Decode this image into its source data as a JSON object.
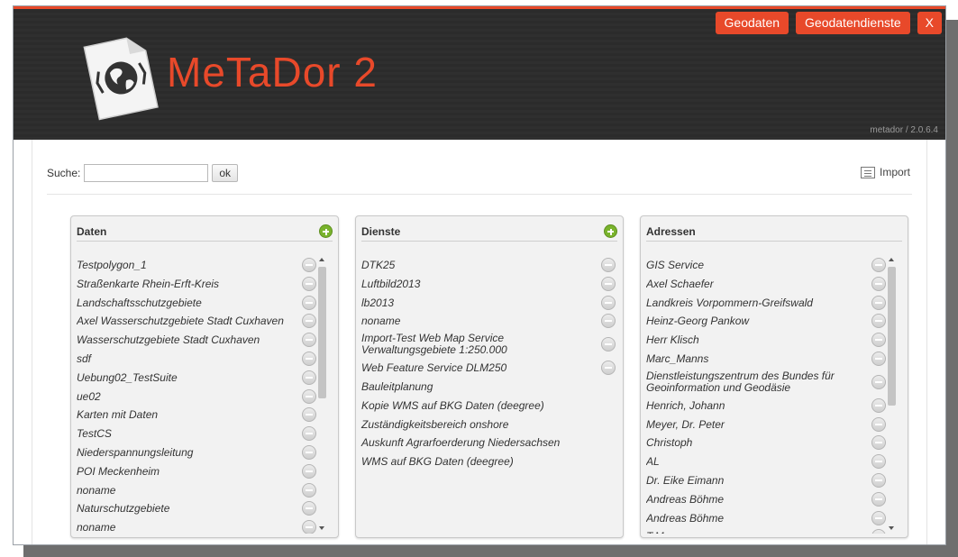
{
  "header": {
    "brand_part1": "MeTa",
    "brand_part2": "Dor 2",
    "version": "metador / 2.0.6.4",
    "nav": {
      "geodaten": "Geodaten",
      "geodatendienste": "Geodatendienste",
      "close": "X"
    }
  },
  "search": {
    "label": "Suche:",
    "value": "",
    "button": "ok"
  },
  "import_label": "Import",
  "panels": {
    "daten": {
      "title": "Daten",
      "items": [
        {
          "label": "Testpolygon_1"
        },
        {
          "label": "Straßenkarte Rhein-Erft-Kreis"
        },
        {
          "label": "Landschaftsschutzgebiete"
        },
        {
          "label": "Axel Wasserschutzgebiete Stadt Cuxhaven"
        },
        {
          "label": "Wasserschutzgebiete Stadt Cuxhaven"
        },
        {
          "label": "sdf"
        },
        {
          "label": "Uebung02_TestSuite"
        },
        {
          "label": "ue02"
        },
        {
          "label": "Karten mit Daten"
        },
        {
          "label": "TestCS"
        },
        {
          "label": "Niederspannungsleitung"
        },
        {
          "label": "POI Meckenheim"
        },
        {
          "label": "noname"
        },
        {
          "label": "Naturschutzgebiete"
        },
        {
          "label": "noname"
        }
      ]
    },
    "dienste": {
      "title": "Dienste",
      "items": [
        {
          "label": "DTK25",
          "removable": true
        },
        {
          "label": "Luftbild2013",
          "removable": true
        },
        {
          "label": "lb2013",
          "removable": true
        },
        {
          "label": "noname",
          "removable": true
        },
        {
          "label": "Import-Test Web Map Service Verwaltungsgebiete 1:250.000",
          "removable": true,
          "two_line": true
        },
        {
          "label": "Web Feature Service DLM250",
          "removable": true
        },
        {
          "label": "Bauleitplanung",
          "removable": false
        },
        {
          "label": "Kopie WMS auf BKG Daten (deegree)",
          "removable": false
        },
        {
          "label": "Zuständigkeitsbereich onshore",
          "removable": false
        },
        {
          "label": "Auskunft Agrarfoerderung Niedersachsen",
          "removable": false
        },
        {
          "label": "WMS auf BKG Daten (deegree)",
          "removable": false
        }
      ]
    },
    "adressen": {
      "title": "Adressen",
      "items": [
        {
          "label": "GIS Service"
        },
        {
          "label": "Axel Schaefer"
        },
        {
          "label": "Landkreis Vorpommern-Greifswald"
        },
        {
          "label": "Heinz-Georg Pankow"
        },
        {
          "label": "Herr Klisch"
        },
        {
          "label": "Marc_Manns"
        },
        {
          "label": "Dienstleistungszentrum des Bundes für Geoinformation und Geodäsie",
          "two_line": true
        },
        {
          "label": "Henrich, Johann"
        },
        {
          "label": "Meyer, Dr. Peter"
        },
        {
          "label": "Christoph"
        },
        {
          "label": "AL"
        },
        {
          "label": "Dr. Eike Eimann"
        },
        {
          "label": "Andreas Böhme"
        },
        {
          "label": "Andreas Böhme"
        },
        {
          "label": "T.M."
        }
      ]
    }
  },
  "colors": {
    "accent": "#e8492a",
    "header_bg": "#2c2c2c",
    "add_green": "#79b32c"
  }
}
